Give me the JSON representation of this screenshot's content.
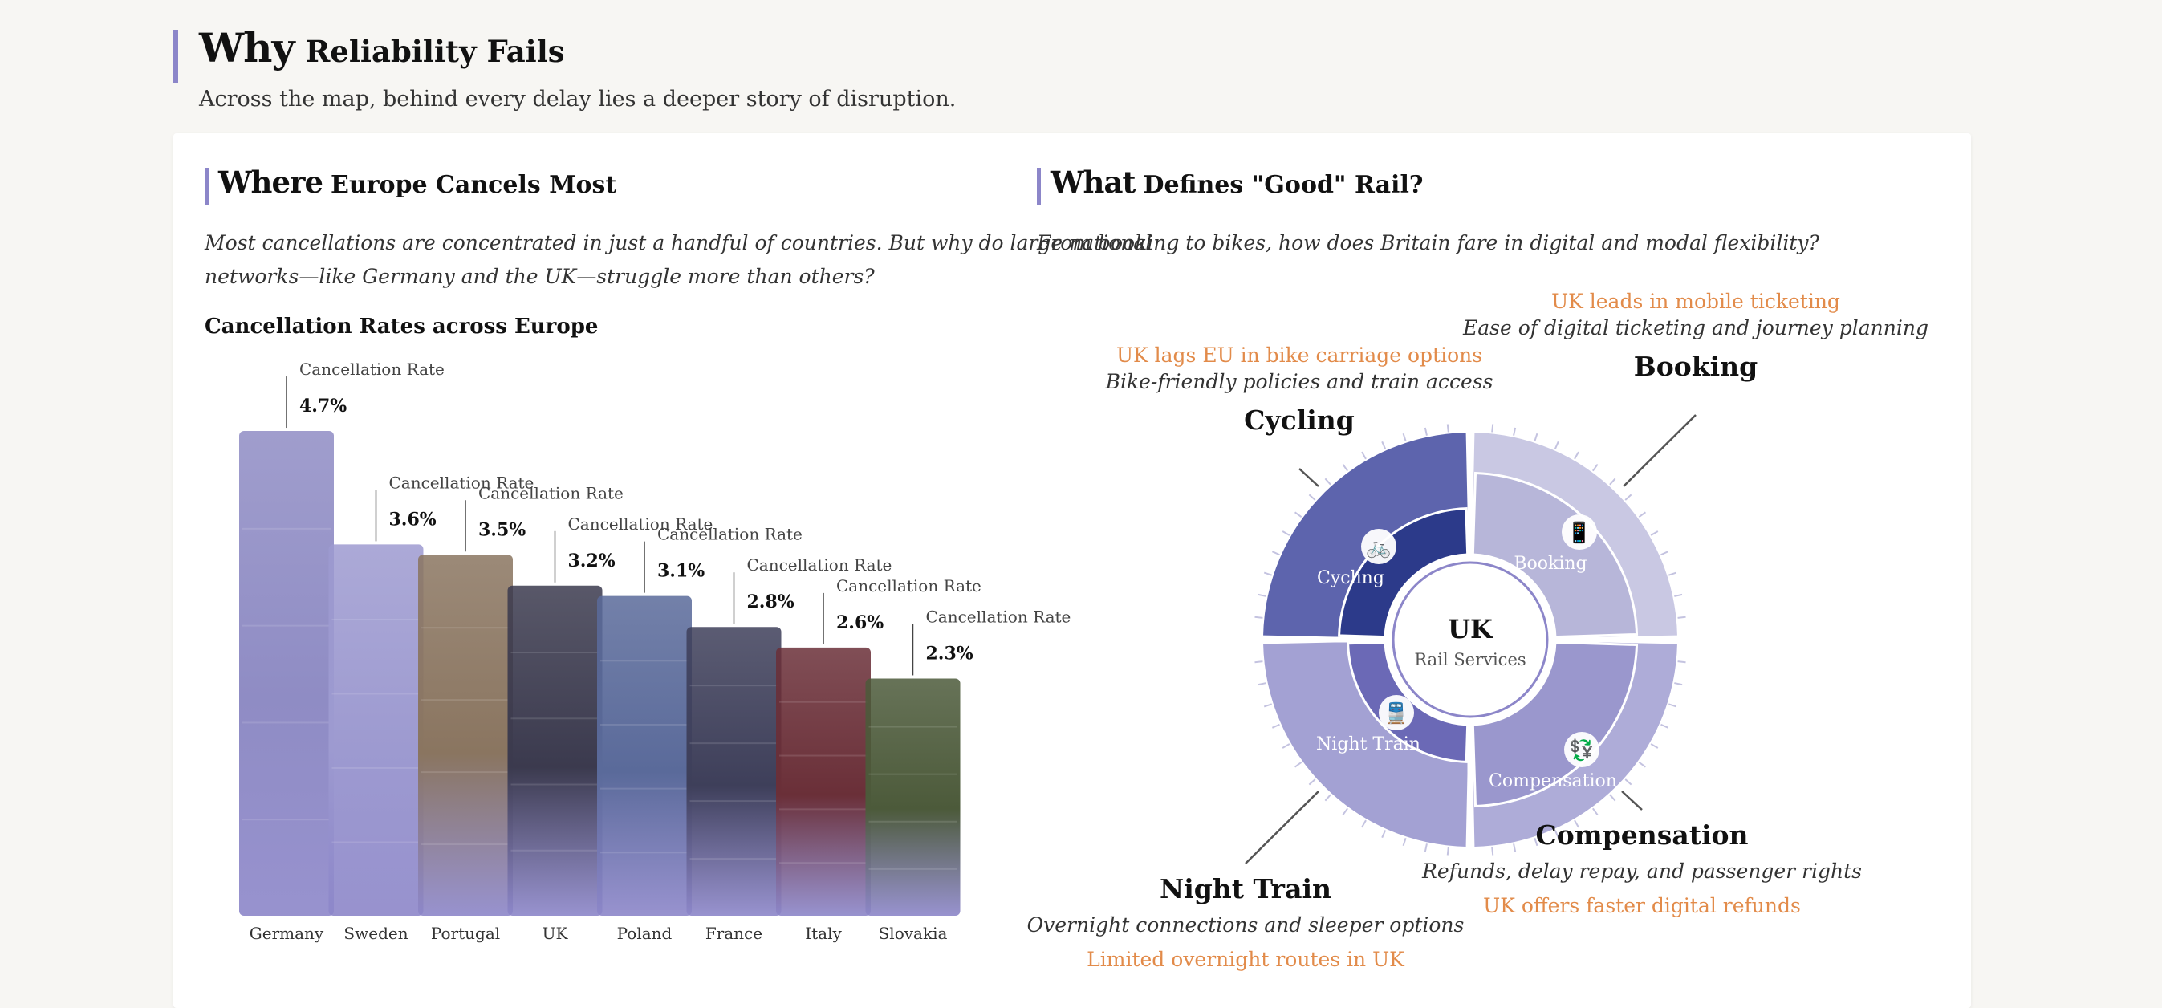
{
  "header": {
    "title_big": "Why",
    "title_small": "Reliability Fails",
    "subtitle": "Across the map, behind every delay lies a deeper story of disruption."
  },
  "where": {
    "title_big": "Where",
    "title_small": "Europe Cancels Most",
    "desc_line1": "Most cancellations are concentrated in just a handful of countries. But why do large national",
    "desc_line2": "networks—like Germany and the UK—struggle more than others?",
    "chart_title": "Cancellation Rates across Europe"
  },
  "what": {
    "title_big": "What",
    "title_small": "Defines \"Good\" Rail?",
    "desc": "From booking to bikes, how does Britain fare in digital and modal flexibility?"
  },
  "chart_data": {
    "type": "bar",
    "title": "Cancellation Rates across Europe",
    "series_label": "Cancellation Rate",
    "categories": [
      "Germany",
      "Sweden",
      "Portugal",
      "UK",
      "Poland",
      "France",
      "Italy",
      "Slovakia"
    ],
    "values": [
      4.7,
      3.6,
      3.5,
      3.2,
      3.1,
      2.8,
      2.6,
      2.3
    ],
    "value_labels": [
      "4.7%",
      "3.6%",
      "3.5%",
      "3.2%",
      "3.1%",
      "2.8%",
      "2.6%",
      "2.3%"
    ],
    "bar_colors": [
      "#8f8cc4",
      "#9d9ad0",
      "#8a7560",
      "#3b3a4e",
      "#5a6a9a",
      "#3e3f5a",
      "#6a2f38",
      "#4c5a3a"
    ],
    "accent": "#8c86c9"
  },
  "radial": {
    "center_title": "UK",
    "center_sub": "Rail Services",
    "segments": [
      {
        "name": "Booking",
        "inner_label": "Booking",
        "icon": "mobile-phone-icon",
        "icon_glyph": "📱",
        "note": "UK leads in mobile ticketing",
        "desc": "Ease of digital ticketing and journey planning",
        "level": 0.78,
        "color": "#b7b6d9",
        "outer_color": "#c9c8e3"
      },
      {
        "name": "Compensation",
        "inner_label": "Compensation",
        "icon": "refund-ticket-icon",
        "icon_glyph": "💱",
        "note": "UK offers faster digital refunds",
        "desc": "Refunds, delay repay, and passenger rights",
        "level": 0.78,
        "color": "#9a97cd",
        "outer_color": "#aeacd8"
      },
      {
        "name": "Night Train",
        "inner_label": "Night Train",
        "icon": "train-icon",
        "icon_glyph": "🚆",
        "note": "Limited overnight routes in UK",
        "desc": "Overnight connections and sleeper options",
        "level": 0.38,
        "color": "#6b69b6",
        "outer_color": "#a3a1d3"
      },
      {
        "name": "Cycling",
        "inner_label": "Cycling",
        "icon": "bicycle-icon",
        "icon_glyph": "🚲",
        "note": "UK lags EU in bike carriage options",
        "desc": "Bike-friendly policies and train access",
        "level": 0.46,
        "color": "#2c3a8a",
        "outer_color": "#5d64ad"
      }
    ]
  }
}
